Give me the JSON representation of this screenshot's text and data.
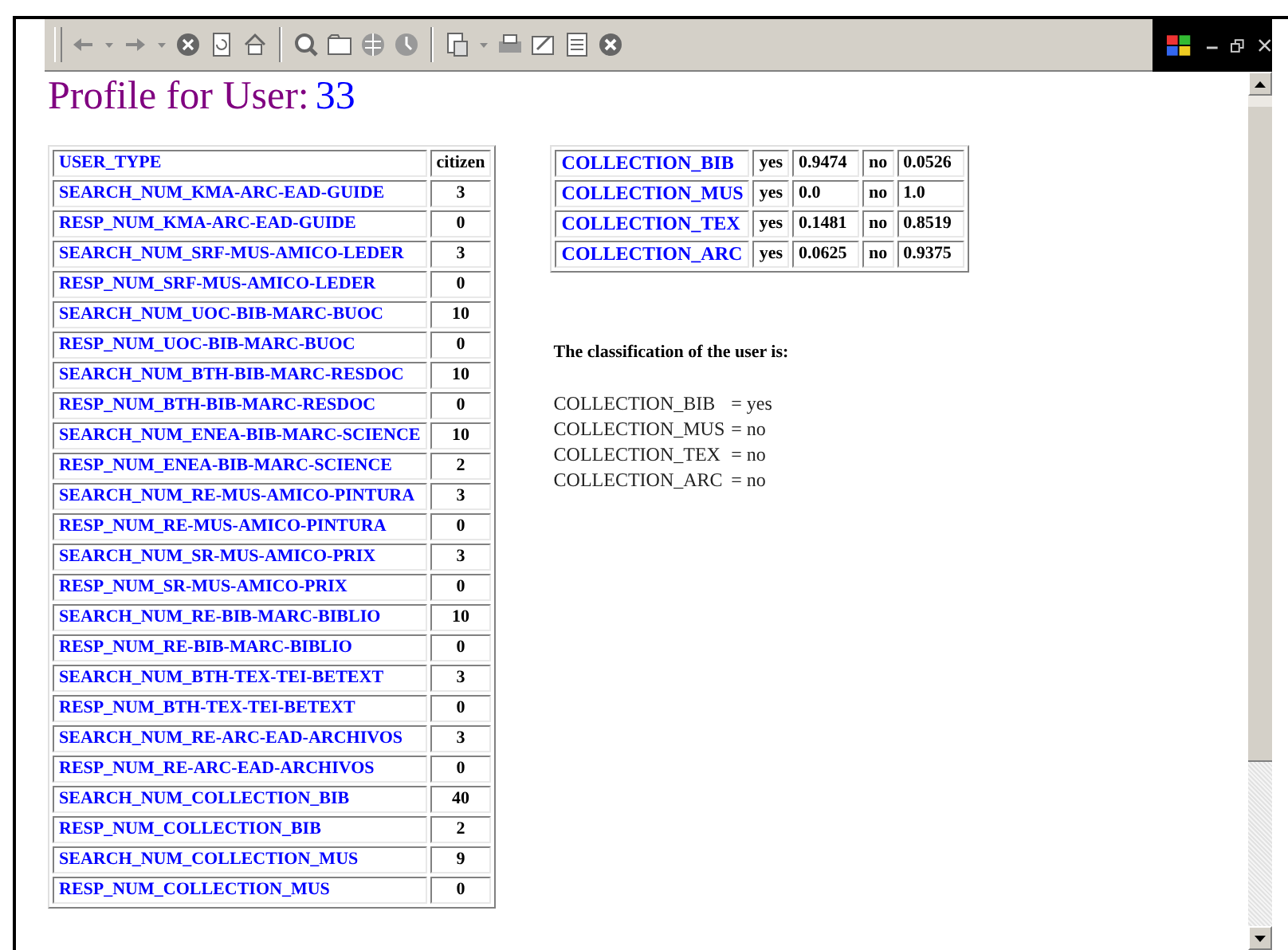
{
  "title": {
    "label": "Profile for User:",
    "user_id": "33"
  },
  "attributes": [
    {
      "name": "USER_TYPE",
      "value": "citizen",
      "kind": "header"
    },
    {
      "name": "SEARCH_NUM_KMA-ARC-EAD-GUIDE",
      "value": "3",
      "kind": "count"
    },
    {
      "name": "RESP_NUM_KMA-ARC-EAD-GUIDE",
      "value": "0",
      "kind": "count"
    },
    {
      "name": "SEARCH_NUM_SRF-MUS-AMICO-LEDER",
      "value": "3",
      "kind": "count"
    },
    {
      "name": "RESP_NUM_SRF-MUS-AMICO-LEDER",
      "value": "0",
      "kind": "count"
    },
    {
      "name": "SEARCH_NUM_UOC-BIB-MARC-BUOC",
      "value": "10",
      "kind": "count"
    },
    {
      "name": "RESP_NUM_UOC-BIB-MARC-BUOC",
      "value": "0",
      "kind": "count"
    },
    {
      "name": "SEARCH_NUM_BTH-BIB-MARC-RESDOC",
      "value": "10",
      "kind": "count"
    },
    {
      "name": "RESP_NUM_BTH-BIB-MARC-RESDOC",
      "value": "0",
      "kind": "count"
    },
    {
      "name": "SEARCH_NUM_ENEA-BIB-MARC-SCIENCE",
      "value": "10",
      "kind": "count"
    },
    {
      "name": "RESP_NUM_ENEA-BIB-MARC-SCIENCE",
      "value": "2",
      "kind": "count"
    },
    {
      "name": "SEARCH_NUM_RE-MUS-AMICO-PINTURA",
      "value": "3",
      "kind": "count"
    },
    {
      "name": "RESP_NUM_RE-MUS-AMICO-PINTURA",
      "value": "0",
      "kind": "count"
    },
    {
      "name": "SEARCH_NUM_SR-MUS-AMICO-PRIX",
      "value": "3",
      "kind": "count"
    },
    {
      "name": "RESP_NUM_SR-MUS-AMICO-PRIX",
      "value": "0",
      "kind": "count"
    },
    {
      "name": "SEARCH_NUM_RE-BIB-MARC-BIBLIO",
      "value": "10",
      "kind": "count"
    },
    {
      "name": "RESP_NUM_RE-BIB-MARC-BIBLIO",
      "value": "0",
      "kind": "count"
    },
    {
      "name": "SEARCH_NUM_BTH-TEX-TEI-BETEXT",
      "value": "3",
      "kind": "count"
    },
    {
      "name": "RESP_NUM_BTH-TEX-TEI-BETEXT",
      "value": "0",
      "kind": "count"
    },
    {
      "name": "SEARCH_NUM_RE-ARC-EAD-ARCHIVOS",
      "value": "3",
      "kind": "count"
    },
    {
      "name": "RESP_NUM_RE-ARC-EAD-ARCHIVOS",
      "value": "0",
      "kind": "count"
    },
    {
      "name": "SEARCH_NUM_COLLECTION_BIB",
      "value": "40",
      "kind": "count"
    },
    {
      "name": "RESP_NUM_COLLECTION_BIB",
      "value": "2",
      "kind": "count"
    },
    {
      "name": "SEARCH_NUM_COLLECTION_MUS",
      "value": "9",
      "kind": "count"
    },
    {
      "name": "RESP_NUM_COLLECTION_MUS",
      "value": "0",
      "kind": "count"
    }
  ],
  "probabilities": [
    {
      "collection": "COLLECTION_BIB",
      "yes_label": "yes",
      "yes_value": "0.9474",
      "no_label": "no",
      "no_value": "0.0526"
    },
    {
      "collection": "COLLECTION_MUS",
      "yes_label": "yes",
      "yes_value": "0.0",
      "no_label": "no",
      "no_value": "1.0"
    },
    {
      "collection": "COLLECTION_TEX",
      "yes_label": "yes",
      "yes_value": "0.1481",
      "no_label": "no",
      "no_value": "0.8519"
    },
    {
      "collection": "COLLECTION_ARC",
      "yes_label": "yes",
      "yes_value": "0.0625",
      "no_label": "no",
      "no_value": "0.9375"
    }
  ],
  "classification": {
    "heading": "The classification of the user is:",
    "results": [
      {
        "collection": "COLLECTION_BIB",
        "value": "= yes"
      },
      {
        "collection": "COLLECTION_MUS",
        "value": "= no"
      },
      {
        "collection": "COLLECTION_TEX",
        "value": "= no"
      },
      {
        "collection": "COLLECTION_ARC",
        "value": "= no"
      }
    ]
  }
}
